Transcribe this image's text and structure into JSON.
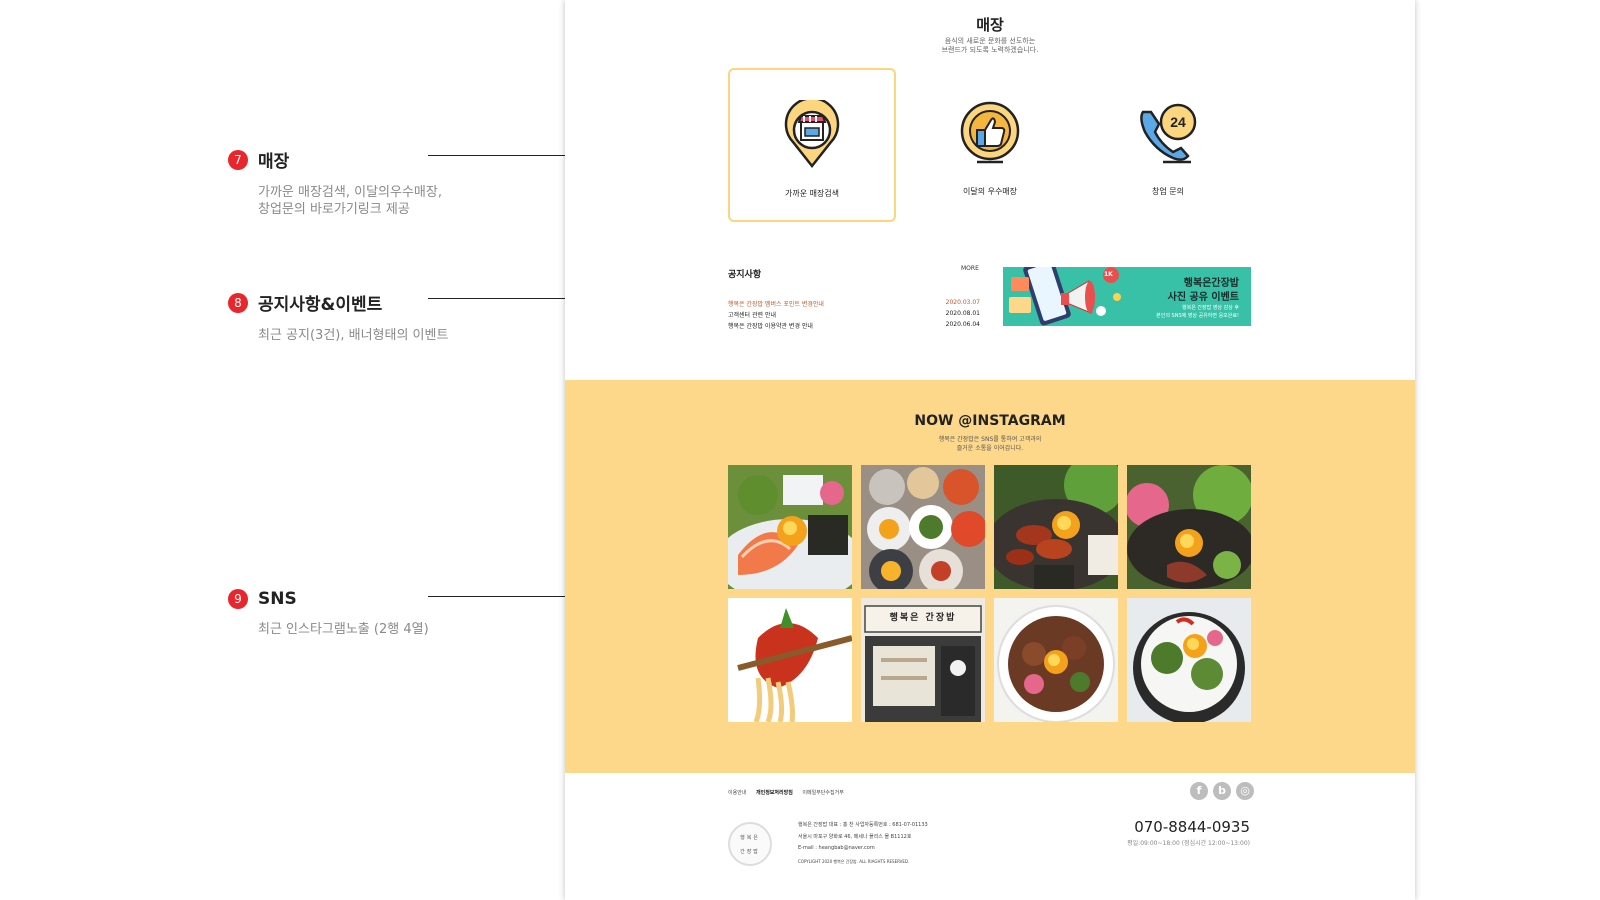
{
  "annotations": [
    {
      "num": "7",
      "title": "매장",
      "desc": "가까운 매장검색, 이달의우수매장,\n창업문의 바로가기링크 제공"
    },
    {
      "num": "8",
      "title": "공지사항&이벤트",
      "desc": "최근 공지(3건), 배너형태의 이벤트"
    },
    {
      "num": "9",
      "title": "SNS",
      "desc": "최근 인스타그램노출 (2행 4열)"
    }
  ],
  "store": {
    "title": "매장",
    "subtitle": "음식의 새로운 문화를 선도하는\n브랜드가 되도록 노력하겠습니다.",
    "cards": [
      {
        "label": "가까운 매장검색",
        "icon": "store-pin-icon"
      },
      {
        "label": "이달의 우수매장",
        "icon": "thumbs-up-icon"
      },
      {
        "label": "창업 문의",
        "icon": "phone-24-icon"
      }
    ]
  },
  "notice": {
    "title": "공지사항",
    "more": "MORE",
    "items": [
      {
        "text": "행복은 간장밥 멤버스 포인트 변경안내",
        "date": "2020.03.07"
      },
      {
        "text": "고객센터 관련 안내",
        "date": "2020.08.01"
      },
      {
        "text": "행복은 간장밥 이용약관 변경 안내",
        "date": "2020.06.04"
      }
    ]
  },
  "event_banner": {
    "line1": "행복은간장밥",
    "line2": "사진 공유 이벤트",
    "line3": "행복은 간장밥 영상 감상 후\n본인의 SNS에 영상 공유하면 응모완료!",
    "badge": "1K",
    "bg_color": "#38c1a6"
  },
  "instagram": {
    "title": "NOW @INSTAGRAM",
    "subtitle": "행복은 간장밥은 SNS를 통하여 고객과의\n즐거운 소통을 이어갑니다.",
    "sign_text": "행복은 간장밥",
    "bg_color": "#fdd88a"
  },
  "footer": {
    "links": [
      "이용안내",
      "개인정보처리방침",
      "이메일무단수집거부"
    ],
    "sns": [
      {
        "glyph": "f",
        "icon": "facebook-icon"
      },
      {
        "glyph": "b",
        "icon": "blog-icon"
      },
      {
        "glyph": "◎",
        "icon": "instagram-icon"
      }
    ],
    "logo_line1": "행복은",
    "logo_line2": "간장밥",
    "info": [
      "행복은 간장밥 대표 : 홍 찬 사업자등록번호 : 681-07-01133",
      "서울시 마포구 양화로 46, 메세나 폴리스 몰 B1112호",
      "E-mail : heangbab@naver.com",
      "COPYLIGHT 2020 행복은 간장밥. ALL RIAGHTS RESERVED."
    ],
    "phone": "070-8844-0935",
    "hours": "평일:09:00~18:00 (점심시간 12:00~13:00)"
  }
}
